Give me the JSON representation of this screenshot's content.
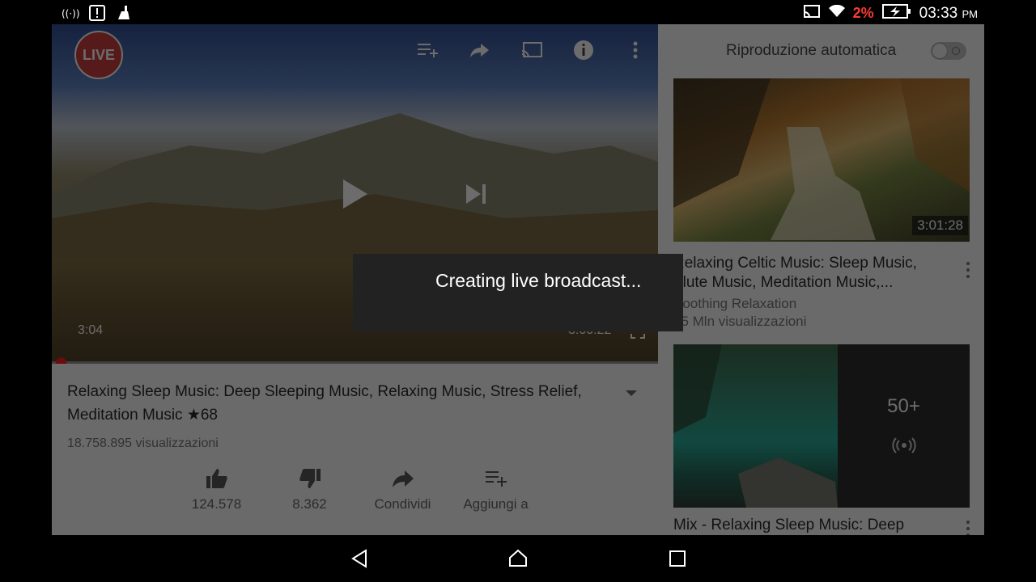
{
  "status_bar": {
    "left_icons": [
      "wireless-broadcast-icon",
      "alert-icon",
      "cleaner-icon"
    ],
    "right_icons": [
      "cast-icon",
      "wifi-icon",
      "battery-charging-icon"
    ],
    "battery_percent": "2%",
    "time": "03:33",
    "time_suffix": "PM"
  },
  "player": {
    "live_badge": "LIVE",
    "current_time": "3:04",
    "duration": "3:00:22",
    "progress_fraction": 0.0,
    "top_controls": [
      "add-to-playlist-icon",
      "share-icon",
      "cast-icon",
      "info-icon",
      "more-vert-icon"
    ],
    "center_controls": [
      "play-icon",
      "skip-next-icon"
    ]
  },
  "video": {
    "title": "Relaxing Sleep Music: Deep Sleeping Music, Relaxing Music, Stress Relief, Meditation Music ★68",
    "views": "18.758.895 visualizzazioni",
    "actions": [
      {
        "icon": "thumbs-up-icon",
        "label": "124.578"
      },
      {
        "icon": "thumbs-down-icon",
        "label": "8.362"
      },
      {
        "icon": "share-icon",
        "label": "Condividi"
      },
      {
        "icon": "add-to-playlist-icon",
        "label": "Aggiungi a"
      }
    ]
  },
  "sidebar": {
    "autoplay_label": "Riproduzione automatica",
    "autoplay_on": false,
    "items": [
      {
        "title": "Relaxing Celtic Music: Sleep Music, Flute Music, Meditation Music,...",
        "channel": "Soothing Relaxation",
        "views": "15 Mln visualizzazioni",
        "duration": "3:01:28"
      },
      {
        "title": "Mix - Relaxing Sleep Music: Deep",
        "mix_count": "50+"
      }
    ]
  },
  "toast": {
    "message": "Creating live broadcast..."
  },
  "nav_bar": {
    "buttons": [
      "back-icon",
      "home-icon",
      "recents-icon"
    ]
  }
}
